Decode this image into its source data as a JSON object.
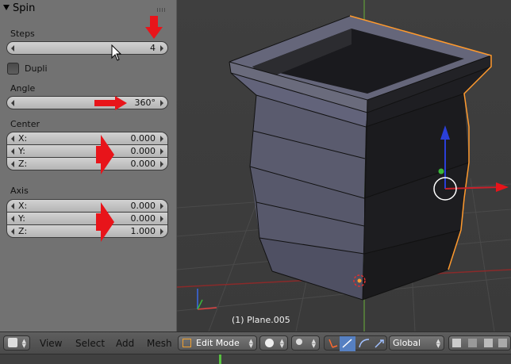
{
  "panel": {
    "title": "Spin",
    "steps": {
      "label": "Steps",
      "value": "4"
    },
    "dupli": {
      "label": "Dupli",
      "checked": false
    },
    "angle": {
      "label": "Angle",
      "value": "360°"
    },
    "center": {
      "label": "Center",
      "fields": [
        {
          "name": "X:",
          "value": "0.000"
        },
        {
          "name": "Y:",
          "value": "0.000"
        },
        {
          "name": "Z:",
          "value": "0.000"
        }
      ]
    },
    "axis": {
      "label": "Axis",
      "fields": [
        {
          "name": "X:",
          "value": "0.000"
        },
        {
          "name": "Y:",
          "value": "0.000"
        },
        {
          "name": "Z:",
          "value": "1.000"
        }
      ]
    }
  },
  "viewport": {
    "object_label": "(1) Plane.005"
  },
  "header": {
    "menus": {
      "view": "View",
      "select": "Select",
      "add": "Add",
      "mesh": "Mesh"
    },
    "mode": "Edit Mode",
    "orientation": "Global"
  },
  "colors": {
    "annotation_arrow": "#e8141a",
    "selection": "#ff9a2e",
    "x_axis": "#c8202a",
    "y_axis": "#5aa028",
    "z_axis": "#2a3fd8"
  }
}
